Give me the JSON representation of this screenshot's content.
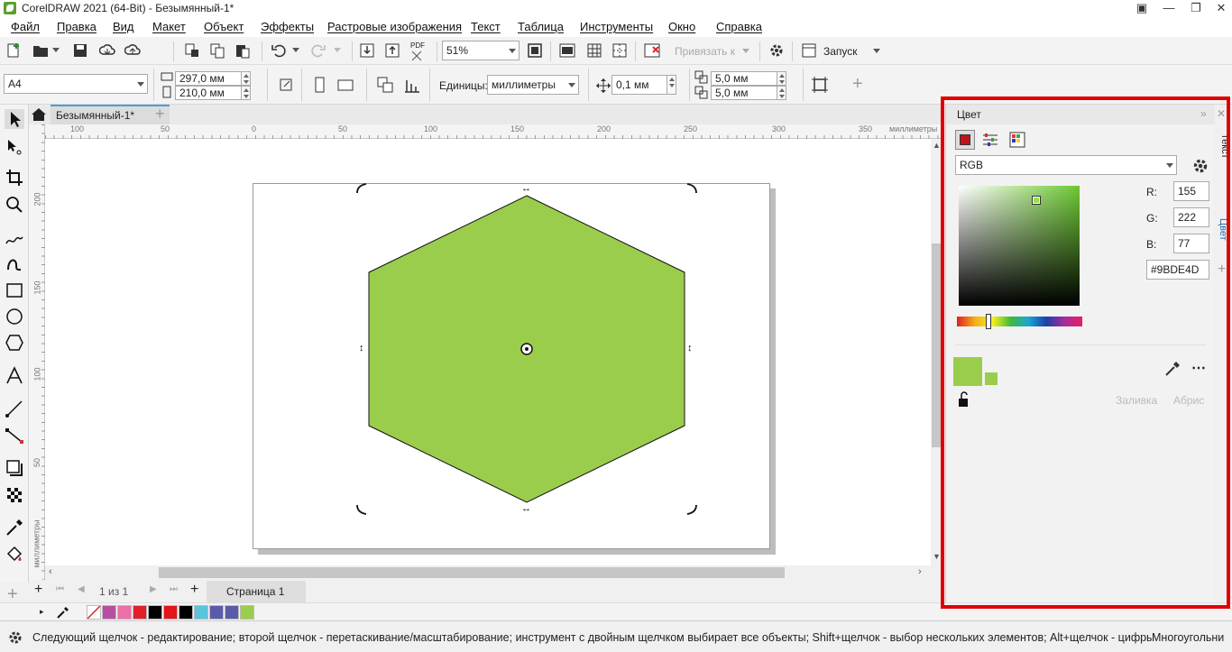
{
  "window": {
    "title": "CorelDRAW 2021 (64-Bit) - Безымянный-1*"
  },
  "menu": [
    "Файл",
    "Правка",
    "Вид",
    "Макет",
    "Объект",
    "Эффекты",
    "Растровые изображения",
    "Текст",
    "Таблица",
    "Инструменты",
    "Окно",
    "Справка"
  ],
  "toolbar": {
    "zoom_value": "51%",
    "snap_label": "Привязать к",
    "launch_label": "Запуск",
    "pdf_label": "PDF"
  },
  "property_bar": {
    "page_size": "A4",
    "width": "297,0 мм",
    "height": "210,0 мм",
    "units_label": "Единицы:",
    "units_value": "миллиметры",
    "nudge": "0,1 мм",
    "dup_x": "5,0 мм",
    "dup_y": "5,0 мм"
  },
  "document": {
    "tab_title": "Безымянный-1*"
  },
  "rulers": {
    "h_ticks": [
      "100",
      "50",
      "0",
      "50",
      "100",
      "150",
      "200",
      "250",
      "300",
      "350"
    ],
    "h_unit": "миллиметры",
    "v_ticks": [
      "200",
      "150",
      "100",
      "50"
    ],
    "v_unit": "миллиметры"
  },
  "shape": {
    "fill": "#9BCD4D",
    "type": "hexagon"
  },
  "page_nav": {
    "counter": "1 из 1",
    "page_tab": "Страница 1"
  },
  "palette": [
    "#ffffff",
    "#b84ea0",
    "#ec6fa8",
    "#e2202a",
    "#000000",
    "#e4141b",
    "#000000",
    "#58c5da",
    "#5a5ba8",
    "#5a5ba8",
    "#9bcd4d"
  ],
  "status": {
    "hint": "Следующий щелчок - редактирование; второй щелчок - перетаскивание/масштабирование; инструмент с двойным щелчком выбирает все объекты; Shift+щелчок - выбор нескольких элементов; Alt+щелчок - цифры",
    "object_type": "Многоугольни"
  },
  "color_docker": {
    "title": "Цвет",
    "model": "RGB",
    "r_label": "R:",
    "r_value": "155",
    "g_label": "G:",
    "g_value": "222",
    "b_label": "B:",
    "b_value": "77",
    "hex_value": "#9BDE4D",
    "fill_label": "Заливка",
    "outline_label": "Абрис",
    "current_color": "#9bcd4d"
  },
  "side_tabs": [
    "Текст",
    "Цвет"
  ]
}
